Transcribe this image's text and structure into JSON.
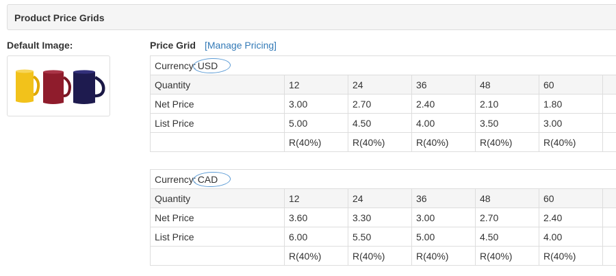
{
  "panel": {
    "title": "Product Price Grids"
  },
  "default_image": {
    "label": "Default Image:",
    "icon": "mugs-image"
  },
  "price_grid": {
    "label": "Price Grid",
    "manage_link": "[Manage Pricing]"
  },
  "grids": [
    {
      "currency_label": "Currency:",
      "currency_code": "USD",
      "rows": [
        {
          "label": "Quantity",
          "values": [
            "12",
            "24",
            "36",
            "48",
            "60"
          ]
        },
        {
          "label": "Net Price",
          "values": [
            "3.00",
            "2.70",
            "2.40",
            "2.10",
            "1.80"
          ]
        },
        {
          "label": "List Price",
          "values": [
            "5.00",
            "4.50",
            "4.00",
            "3.50",
            "3.00"
          ]
        },
        {
          "label": "",
          "values": [
            "R(40%)",
            "R(40%)",
            "R(40%)",
            "R(40%)",
            "R(40%)"
          ]
        }
      ]
    },
    {
      "currency_label": "Currency:",
      "currency_code": "CAD",
      "rows": [
        {
          "label": "Quantity",
          "values": [
            "12",
            "24",
            "36",
            "48",
            "60"
          ]
        },
        {
          "label": "Net Price",
          "values": [
            "3.60",
            "3.30",
            "3.00",
            "2.70",
            "2.40"
          ]
        },
        {
          "label": "List Price",
          "values": [
            "6.00",
            "5.50",
            "5.00",
            "4.50",
            "4.00"
          ]
        },
        {
          "label": "",
          "values": [
            "R(40%)",
            "R(40%)",
            "R(40%)",
            "R(40%)",
            "R(40%)"
          ]
        }
      ]
    }
  ],
  "colors": {
    "link": "#337ab7",
    "header_bg": "#f5f5f5",
    "border": "#dddddd",
    "circle": "#5b9bd5"
  }
}
